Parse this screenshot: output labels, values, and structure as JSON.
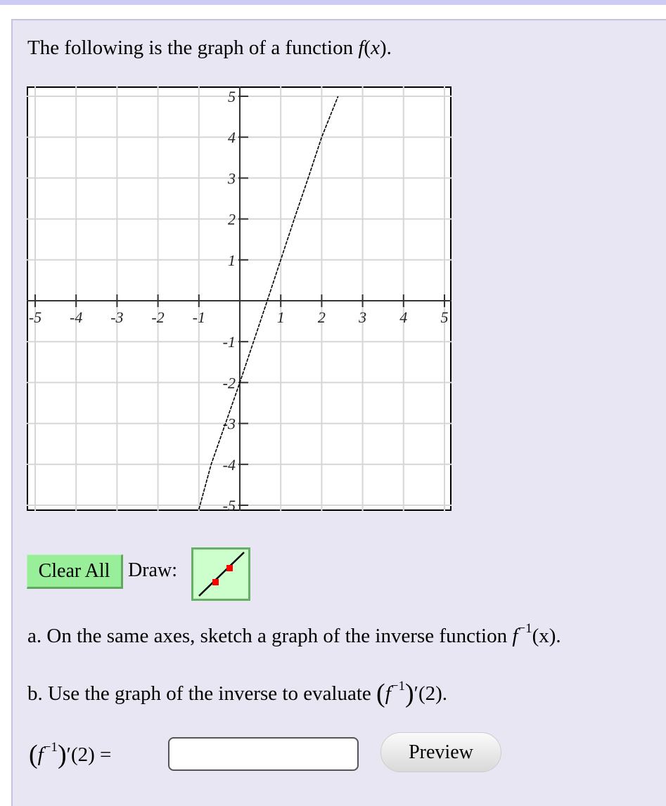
{
  "intro": {
    "text": "The following is the graph of a function ",
    "func": "f",
    "var": "x"
  },
  "chart_data": {
    "type": "line",
    "title": "",
    "xlabel": "",
    "ylabel": "",
    "xlim": [
      -5,
      5
    ],
    "ylim": [
      -5,
      5
    ],
    "grid": true,
    "x_ticks": [
      "-5",
      "-4",
      "-3",
      "-2",
      "-1",
      "1",
      "2",
      "3",
      "4",
      "5"
    ],
    "y_ticks": [
      "5",
      "4",
      "3",
      "2",
      "1",
      "-1",
      "-2",
      "-3",
      "-4",
      "-5"
    ],
    "series": [
      {
        "name": "f(x)",
        "x": [
          -1.0,
          -0.7,
          0,
          0.67,
          1,
          1.33,
          1.67,
          2,
          2.4
        ],
        "y": [
          -5.1,
          -4,
          -2,
          0,
          1,
          2,
          3,
          4,
          5
        ]
      }
    ]
  },
  "toolbar": {
    "clear_label": "Clear All",
    "draw_label": "Draw:",
    "tool_icon": "line-tool-icon"
  },
  "questions": {
    "a": {
      "prefix": "a. On the same axes, sketch a graph of the inverse function ",
      "func": "f",
      "sup": "−1",
      "arg": "(x)."
    },
    "b": {
      "prefix": "b. Use the graph of the inverse to evaluate ",
      "expr_tail": "′(2)."
    }
  },
  "answer": {
    "label_tail": "′(2) =",
    "value": "",
    "placeholder": ""
  },
  "preview_label": "Preview",
  "colors": {
    "button_green": "#99ee99",
    "panel": "#e8e6f2",
    "point_red": "#ff0000"
  }
}
